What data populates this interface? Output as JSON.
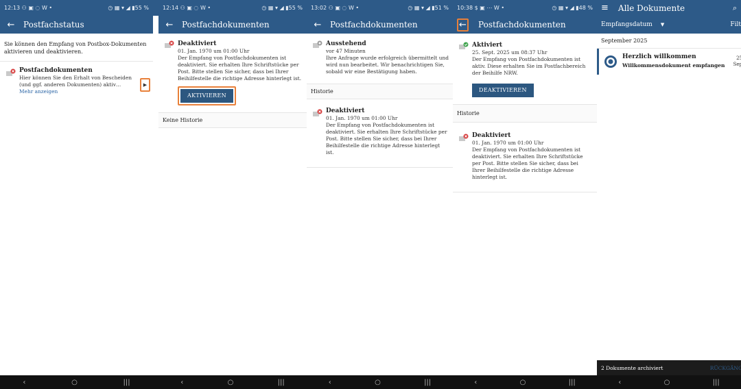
{
  "colors": {
    "primary": "#2d5a88",
    "highlight": "#e8803a",
    "button": "#2c5780",
    "error_badge": "#d63a3a",
    "success_badge": "#3fa34d",
    "pending_badge": "#9a9a9a"
  },
  "nav": {
    "back": "‹",
    "home": "○",
    "recents": "|||"
  },
  "screen1": {
    "status_left": "12:13 ⚇ ▣ ◌ W •",
    "status_right": "◷ ▦ ▾ ◢ ▮55 %",
    "title": "Postfachstatus",
    "intro": "Sie können den Empfang von Postbox-Dokumenten aktivieren und deaktivieren.",
    "entry_title": "Postfachdokumenten",
    "entry_text": "Hier können Sie den Erhalt von Bescheiden (und ggf. anderen Dokumenten) aktiv…",
    "more": "Mehr anzeigen",
    "arrow_icon": "chevron-right-icon"
  },
  "screen2": {
    "status_left": "12:14 ⚇ ▣ ◌ W •",
    "status_right": "◷ ▦ ▾ ◢ ▮55 %",
    "title": "Postfachdokumenten",
    "entry_title": "Deaktiviert",
    "entry_date": "01. Jan. 1970 um 01:00 Uhr",
    "entry_text": "Der Empfang von Postfachdokumenten ist deaktiviert. Sie erhalten Ihre Schriftstücke per Post. Bitte stellen Sie sicher, dass bei Ihrer Beihilfestelle die richtige Adresse hinterlegt ist.",
    "button": "AKTIVIEREN",
    "history_empty": "Keine Historie"
  },
  "screen3": {
    "status_left": "13:02 ⚇ ▣ ◌ W •",
    "status_right": "◷ ▦ ▾ ◢ ▮51 %",
    "title": "Postfachdokumenten",
    "pending_title": "Ausstehend",
    "pending_time": "vor 47 Minuten",
    "pending_text": "Ihre Anfrage wurde erfolgreich übermittelt und wird nun bearbeitet. Wir benachrichtigen Sie, sobald wir eine Bestätigung haben.",
    "history_label": "Historie",
    "hist_title": "Deaktiviert",
    "hist_date": "01. Jan. 1970 um 01:00 Uhr",
    "hist_text": "Der Empfang von Postfachdokumenten ist deaktiviert. Sie erhalten Ihre Schriftstücke per Post. Bitte stellen Sie sicher, dass bei Ihrer Beihilfestelle die richtige Adresse hinterlegt ist."
  },
  "screen4": {
    "status_left": "10:38 $ ▣ ⋯ W •",
    "status_right": "◷ ▦ ▾ ◢ ▮48 %",
    "title": "Postfachdokumenten",
    "active_title": "Aktiviert",
    "active_date": "25. Sept. 2025 um 08:37 Uhr",
    "active_text": "Der Empfang von Postfachdokumenten ist aktiv. Diese erhalten Sie im Postfachbereich der Beihilfe NRW.",
    "button": "DEAKTIVIEREN",
    "history_label": "Historie",
    "hist_title": "Deaktiviert",
    "hist_date": "01. Jan. 1970 um 01:00 Uhr",
    "hist_text": "Der Empfang von Postfachdokumenten ist deaktiviert. Sie erhalten Ihre Schriftstücke per Post. Bitte stellen Sie sicher, dass bei Ihrer Beihilfestelle die richtige Adresse hinterlegt ist."
  },
  "screen5": {
    "title": "Alle Dokumente",
    "sort": "Empfangsdatum",
    "filter": "Filt",
    "month": "September 2025",
    "doc_title": "Herzlich willkommen",
    "doc_sub": "Willkommensdokument empfangen",
    "doc_date_1": "25",
    "doc_date_2": "Sep",
    "archived": "2 Dokumente archiviert",
    "undo": "RÜCKGÄNG"
  }
}
